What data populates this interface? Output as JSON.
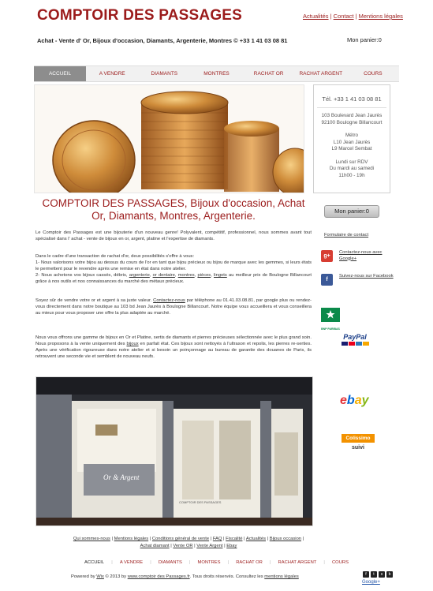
{
  "header": {
    "title": "COMPTOIR DES PASSAGES",
    "top_links": [
      "Actualités",
      "Contact",
      "Mentions légales"
    ],
    "tagline": "Achat - Vente d' Or, Bijoux d'occasion, Diamants, Argenterie, Montres © +33 1 41 03 08 81",
    "cart": "Mon panier:0"
  },
  "nav": {
    "items": [
      "ACCUEIL",
      "A VENDRE",
      "DIAMANTS",
      "MONTRES",
      "RACHAT OR",
      "RACHAT ARGENT",
      "COURS"
    ],
    "active_index": 0
  },
  "info_box": {
    "phone": "Tél. +33 1 41 03 08 81",
    "address": [
      "103 Boulevard Jean Jaurès",
      "92100 Boulogne Billancourt"
    ],
    "metro": [
      "Métro",
      "L10 Jean Jaurès",
      "L9 Marcel Sembat"
    ],
    "hours": [
      "Lundi sur RDV",
      "Du mardi au samedi",
      "11h00 - 19h"
    ]
  },
  "main": {
    "heading": "COMPTOIR DES PASSAGES, Bijoux d'occasion, Achat Or, Diamants, Montres, Argenterie.",
    "p1": "Le Comptoir des Passages est une bijouterie d'un nouveau genre! Polyvalent, compétitif, professionnel, nous sommes avant tout spécialisé dans l' achat - vente de bijoux en or, argent, platine et l'expertise de diamants.",
    "p2_intro": "Dans le cadre d'une transaction de rachat d'or, deux possibilités s'offre à vous:",
    "p2_line1": "1- Nous valorisons votre bijou au dessus du cours de l'or en tant que bijou précieux ou bijou de marque avec les gemmes, si leurs états le permettent pour le revendre après une remise en état dans notre atelier.",
    "p2_line2_a": "2- Nous achetons vos bijoux cassés, débris,",
    "p2_links": [
      "argenterie",
      "or dentaire",
      "montres",
      "pièces",
      "lingots"
    ],
    "p2_line2_b": "au meilleur prix de Boulogne Billancourt grâce à nos outils et nos connaissances du marché des métaux précieux.",
    "p3_a": "Soyez sûr de vendre votre or et argent à sa juste valeur.",
    "p3_link": "Contactez-nous",
    "p3_b": "par téléphone au 01.41.03.08.81, par google plus ou rendez-vous directement dans notre boutique au 103 bd Jean Jaurès à Boulogne Billancourt. Notre équipe vous accueillera et vous conseillera au mieux pour vous proposer une offre la plus adaptée au marché.",
    "p4_a": "Nous vous offrons une gamme de bijoux en Or et Platine, sertis de diamants et pierres précieuses sélectionnée avec le plus grand soin. Nous proposons à la vente uniquement des",
    "p4_link": "bijoux",
    "p4_b": "en parfait état. Ces bijoux sont nettoyés à l'ultrason et repolis, les pierres re-serties. Après une vérification rigoureuse dans notre atelier et si besoin un poinçonnage au bureau de garantie des douanes de Paris, ils retrouvent une seconde vie et semblent de nouveau neufs."
  },
  "store_photo": {
    "sign": "Or & Argent",
    "window_text": "COMPTOIR DES PASSAGES"
  },
  "sidebar": {
    "cart_button": "Mon panier:0",
    "contact_form": "Formulaire de contact",
    "google": "Contactez-nous avec Google+",
    "facebook": "Suivez-nous sur Facebook",
    "bnp": "BNP PARIBAS",
    "paypal": "PayPal",
    "ebay": "ebay",
    "colissimo": "Colissimo",
    "colissimo_suivi": "suivi"
  },
  "footer": {
    "links": [
      "Qui sommes-nous",
      "Mentions légales",
      "Conditions général de vente",
      "FAQ",
      "Fiscalité",
      "Actualités",
      "Bijoux occasion",
      "Achat diamant",
      "Vente OR",
      "Vente Argent",
      "Ebay"
    ],
    "nav": [
      "ACCUEIL",
      "A VENDRE",
      "DIAMANTS",
      "MONTRES",
      "RACHAT OR",
      "RACHAT ARGENT",
      "COURS"
    ],
    "copyright_a": "Powered by",
    "copyright_wix": "Wix",
    "copyright_b": "© 2013 by",
    "copyright_site": "www.comptoir des Passages.fr",
    "copyright_c": ". Tous droits réservés. Consultez les",
    "copyright_mentions": "mentions légales",
    "google_small": "Google+"
  },
  "colors": {
    "brand": "#9b1b1b",
    "nav_active": "#8d8d8d",
    "gold": "#c98a3a"
  }
}
